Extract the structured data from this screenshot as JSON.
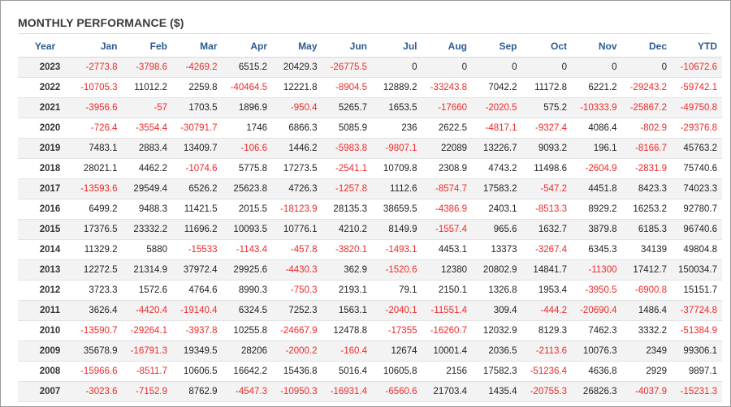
{
  "title": "MONTHLY PERFORMANCE ($)",
  "columns": [
    "Year",
    "Jan",
    "Feb",
    "Mar",
    "Apr",
    "May",
    "Jun",
    "Jul",
    "Aug",
    "Sep",
    "Oct",
    "Nov",
    "Dec",
    "YTD"
  ],
  "rows": [
    {
      "year": "2023",
      "values": [
        "-2773.8",
        "-3798.6",
        "-4269.2",
        "6515.2",
        "20429.3",
        "-26775.5",
        "0",
        "0",
        "0",
        "0",
        "0",
        "0",
        "-10672.6"
      ]
    },
    {
      "year": "2022",
      "values": [
        "-10705.3",
        "11012.2",
        "2259.8",
        "-40464.5",
        "12221.8",
        "-8904.5",
        "12889.2",
        "-33243.8",
        "7042.2",
        "11172.8",
        "6221.2",
        "-29243.2",
        "-59742.1"
      ]
    },
    {
      "year": "2021",
      "values": [
        "-3956.6",
        "-57",
        "1703.5",
        "1896.9",
        "-950.4",
        "5265.7",
        "1653.5",
        "-17660",
        "-2020.5",
        "575.2",
        "-10333.9",
        "-25867.2",
        "-49750.8"
      ]
    },
    {
      "year": "2020",
      "values": [
        "-726.4",
        "-3554.4",
        "-30791.7",
        "1746",
        "6866.3",
        "5085.9",
        "236",
        "2622.5",
        "-4817.1",
        "-9327.4",
        "4086.4",
        "-802.9",
        "-29376.8"
      ]
    },
    {
      "year": "2019",
      "values": [
        "7483.1",
        "2883.4",
        "13409.7",
        "-106.6",
        "1446.2",
        "-5983.8",
        "-9807.1",
        "22089",
        "13226.7",
        "9093.2",
        "196.1",
        "-8166.7",
        "45763.2"
      ]
    },
    {
      "year": "2018",
      "values": [
        "28021.1",
        "4462.2",
        "-1074.6",
        "5775.8",
        "17273.5",
        "-2541.1",
        "10709.8",
        "2308.9",
        "4743.2",
        "11498.6",
        "-2604.9",
        "-2831.9",
        "75740.6"
      ]
    },
    {
      "year": "2017",
      "values": [
        "-13593.6",
        "29549.4",
        "6526.2",
        "25623.8",
        "4726.3",
        "-1257.8",
        "1112.6",
        "-8574.7",
        "17583.2",
        "-547.2",
        "4451.8",
        "8423.3",
        "74023.3"
      ]
    },
    {
      "year": "2016",
      "values": [
        "6499.2",
        "9488.3",
        "11421.5",
        "2015.5",
        "-18123.9",
        "28135.3",
        "38659.5",
        "-4386.9",
        "2403.1",
        "-8513.3",
        "8929.2",
        "16253.2",
        "92780.7"
      ]
    },
    {
      "year": "2015",
      "values": [
        "17376.5",
        "23332.2",
        "11696.2",
        "10093.5",
        "10776.1",
        "4210.2",
        "8149.9",
        "-1557.4",
        "965.6",
        "1632.7",
        "3879.8",
        "6185.3",
        "96740.6"
      ]
    },
    {
      "year": "2014",
      "values": [
        "11329.2",
        "5880",
        "-15533",
        "-1143.4",
        "-457.8",
        "-3820.1",
        "-1493.1",
        "4453.1",
        "13373",
        "-3267.4",
        "6345.3",
        "34139",
        "49804.8"
      ]
    },
    {
      "year": "2013",
      "values": [
        "12272.5",
        "21314.9",
        "37972.4",
        "29925.6",
        "-4430.3",
        "362.9",
        "-1520.6",
        "12380",
        "20802.9",
        "14841.7",
        "-11300",
        "17412.7",
        "150034.7"
      ]
    },
    {
      "year": "2012",
      "values": [
        "3723.3",
        "1572.6",
        "4764.6",
        "8990.3",
        "-750.3",
        "2193.1",
        "79.1",
        "2150.1",
        "1326.8",
        "1953.4",
        "-3950.5",
        "-6900.8",
        "15151.7"
      ]
    },
    {
      "year": "2011",
      "values": [
        "3626.4",
        "-4420.4",
        "-19140.4",
        "6324.5",
        "7252.3",
        "1563.1",
        "-2040.1",
        "-11551.4",
        "309.4",
        "-444.2",
        "-20690.4",
        "1486.4",
        "-37724.8"
      ]
    },
    {
      "year": "2010",
      "values": [
        "-13590.7",
        "-29264.1",
        "-3937.8",
        "10255.8",
        "-24667.9",
        "12478.8",
        "-17355",
        "-16260.7",
        "12032.9",
        "8129.3",
        "7462.3",
        "3332.2",
        "-51384.9"
      ]
    },
    {
      "year": "2009",
      "values": [
        "35678.9",
        "-16791.3",
        "19349.5",
        "28206",
        "-2000.2",
        "-160.4",
        "12674",
        "10001.4",
        "2036.5",
        "-2113.6",
        "10076.3",
        "2349",
        "99306.1"
      ]
    },
    {
      "year": "2008",
      "values": [
        "-15966.6",
        "-8511.7",
        "10606.5",
        "16642.2",
        "15436.8",
        "5016.4",
        "10605.8",
        "2156",
        "17582.3",
        "-51236.4",
        "4636.8",
        "2929",
        "9897.1"
      ]
    },
    {
      "year": "2007",
      "values": [
        "-3023.6",
        "-7152.9",
        "8762.9",
        "-4547.3",
        "-10950.3",
        "-16931.4",
        "-6560.6",
        "21703.4",
        "1435.4",
        "-20755.3",
        "26826.3",
        "-4037.9",
        "-15231.3"
      ]
    }
  ],
  "colors": {
    "header_text": "#2c5b92",
    "negative": "#ee2a2a",
    "positive": "#222222",
    "stripe": "#f3f3f3"
  }
}
